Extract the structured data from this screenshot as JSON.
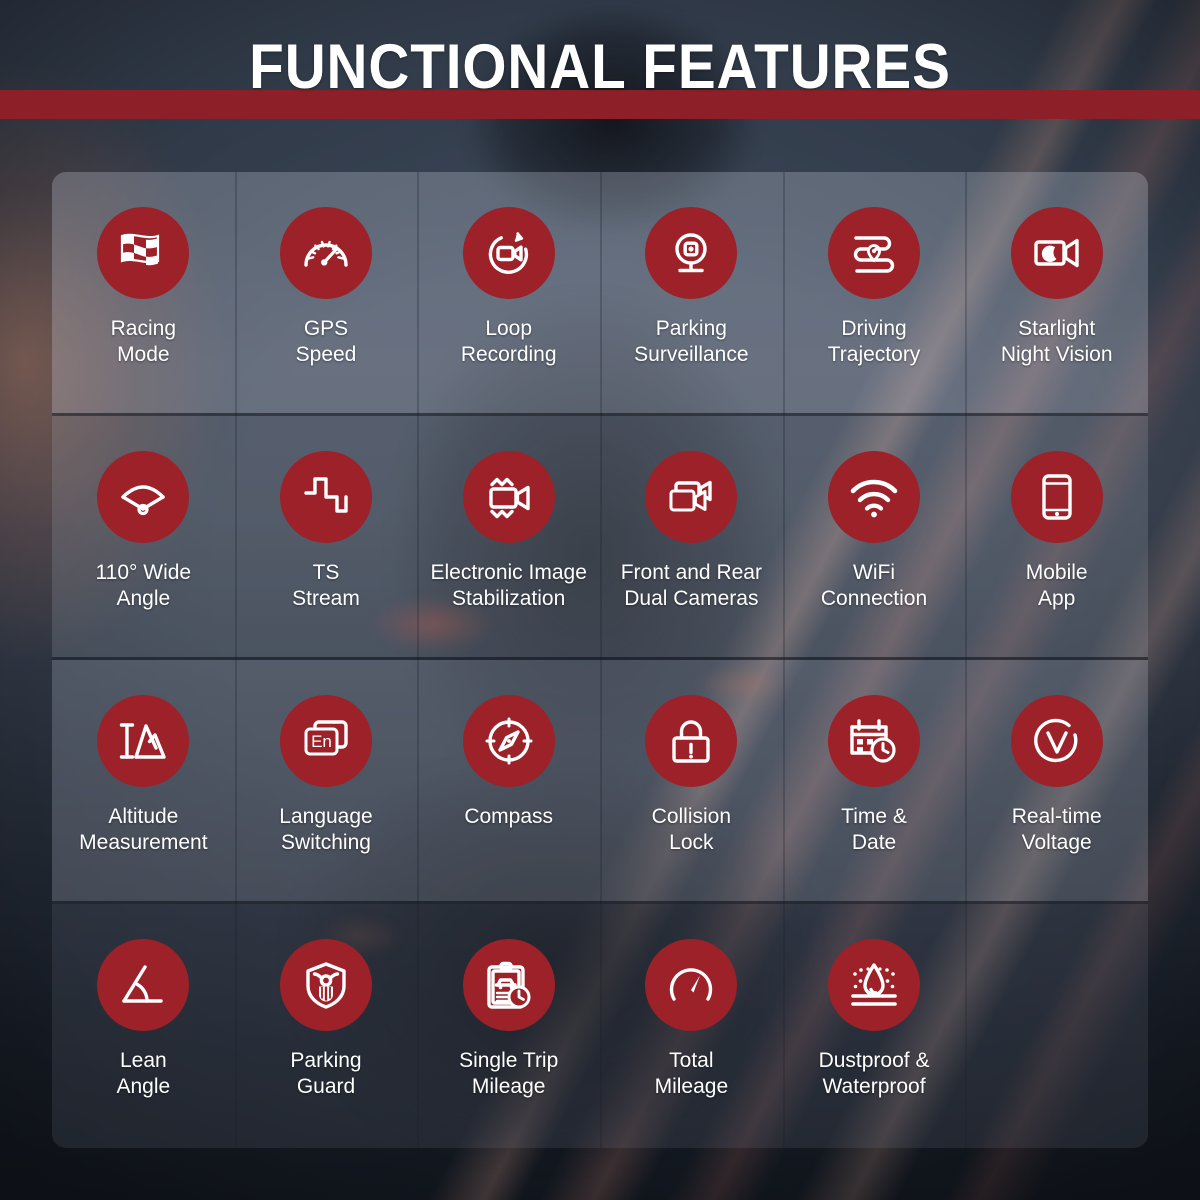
{
  "header": {
    "title": "FUNCTIONAL FEATURES",
    "bar_color": "#8c1f27",
    "title_color": "#ffffff"
  },
  "theme": {
    "accent_red": "#9c2128",
    "background_dark": "#1d2430",
    "panel_overlay": "rgba(196,202,214,0.30)",
    "label_color": "#ffffff"
  },
  "grid": {
    "columns": 6,
    "rows": 4,
    "features": [
      {
        "label": "Racing\nMode",
        "icon": "checkered-flag-icon"
      },
      {
        "label": "GPS\nSpeed",
        "icon": "speedometer-icon"
      },
      {
        "label": "Loop\nRecording",
        "icon": "loop-recording-icon"
      },
      {
        "label": "Parking\nSurveillance",
        "icon": "parking-surveillance-camera-icon"
      },
      {
        "label": "Driving\nTrajectory",
        "icon": "route-pin-icon"
      },
      {
        "label": "Starlight\nNight Vision",
        "icon": "night-vision-camera-icon"
      },
      {
        "label": "110° Wide\nAngle",
        "icon": "wide-angle-icon"
      },
      {
        "label": "TS\nStream",
        "icon": "ts-stream-waveform-icon"
      },
      {
        "label": "Electronic Image\nStabilization",
        "icon": "image-stabilization-camera-icon"
      },
      {
        "label": "Front and Rear\nDual Cameras",
        "icon": "dual-cameras-icon"
      },
      {
        "label": "WiFi\nConnection",
        "icon": "wifi-icon"
      },
      {
        "label": "Mobile\nApp",
        "icon": "mobile-phone-icon"
      },
      {
        "label": "Altitude\nMeasurement",
        "icon": "altitude-mountain-icon"
      },
      {
        "label": "Language\nSwitching",
        "icon": "language-en-card-icon"
      },
      {
        "label": "Compass",
        "icon": "compass-icon"
      },
      {
        "label": "Collision\nLock",
        "icon": "collision-lock-icon"
      },
      {
        "label": "Time &\nDate",
        "icon": "calendar-clock-icon"
      },
      {
        "label": "Real-time\nVoltage",
        "icon": "voltage-circle-icon"
      },
      {
        "label": "Lean\nAngle",
        "icon": "lean-angle-icon"
      },
      {
        "label": "Parking\nGuard",
        "icon": "parking-guard-shield-icon"
      },
      {
        "label": "Single Trip\nMileage",
        "icon": "trip-clipboard-clock-icon"
      },
      {
        "label": "Total\nMileage",
        "icon": "odometer-gauge-icon"
      },
      {
        "label": "Dustproof &\nWaterproof",
        "icon": "dustproof-waterproof-icon"
      },
      {
        "label": "",
        "icon": ""
      }
    ]
  }
}
